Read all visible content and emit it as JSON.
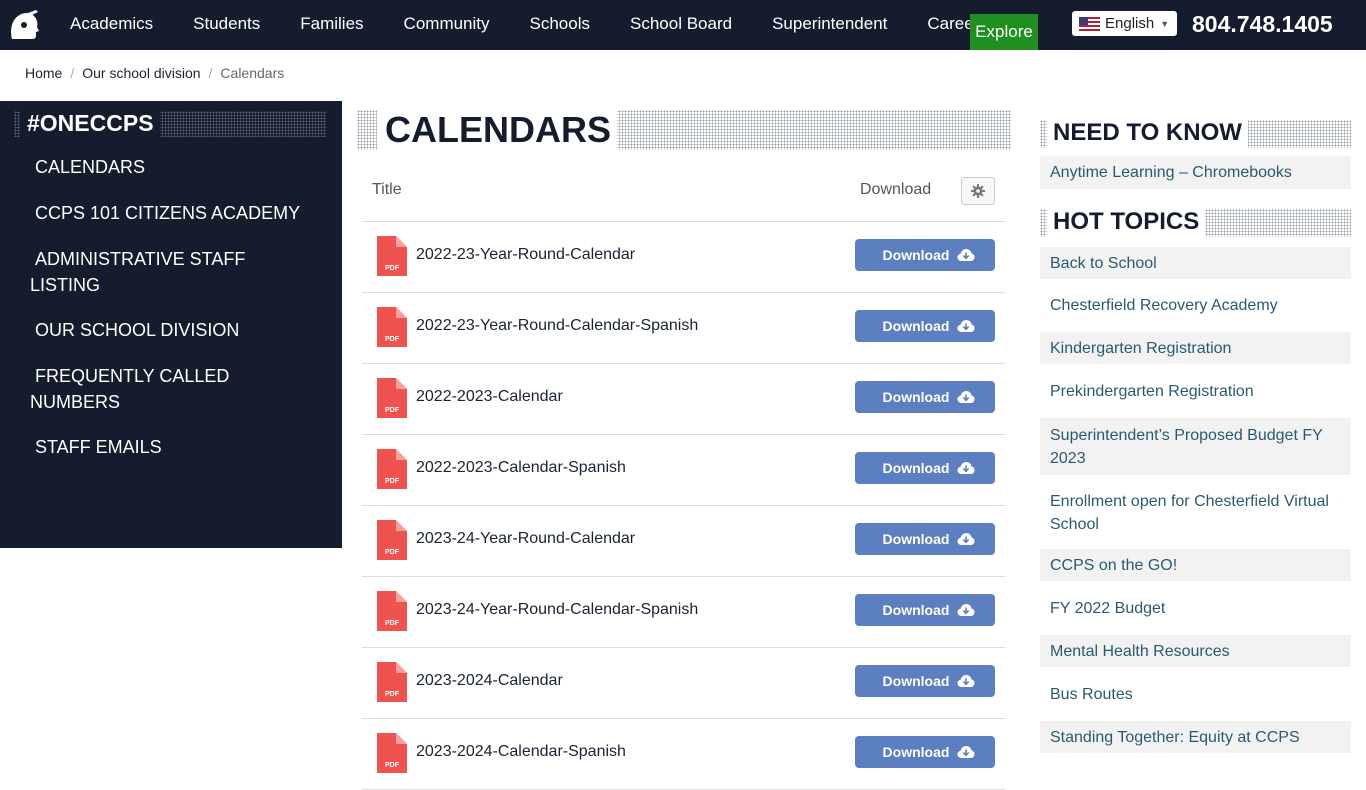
{
  "nav": {
    "items": [
      "Academics",
      "Students",
      "Families",
      "Community",
      "Schools",
      "School Board",
      "Superintendent",
      "Careers"
    ],
    "explore": "Explore",
    "language": "English",
    "phone": "804.748.1405"
  },
  "breadcrumb": {
    "home": "Home",
    "parent": "Our school division",
    "current": "Calendars"
  },
  "sidebar": {
    "heading": "#ONECCPS",
    "items": [
      {
        "label": "CALENDARS"
      },
      {
        "label": "CCPS 101 CITIZENS ACADEMY"
      },
      {
        "label": "ADMINISTRATIVE STAFF LISTING"
      },
      {
        "label": "OUR SCHOOL DIVISION"
      },
      {
        "label": "FREQUENTLY CALLED NUMBERS"
      },
      {
        "label": "STAFF EMAILS"
      }
    ]
  },
  "main": {
    "title": "CALENDARS",
    "columns": {
      "title": "Title",
      "download": "Download"
    },
    "download_label": "Download",
    "file_icon_text": "PDF",
    "files": [
      "2022-23-Year-Round-Calendar",
      "2022-23-Year-Round-Calendar-Spanish",
      "2022-2023-Calendar",
      "2022-2023-Calendar-Spanish",
      "2023-24-Year-Round-Calendar",
      "2023-24-Year-Round-Calendar-Spanish",
      "2023-2024-Calendar",
      "2023-2024-Calendar-Spanish"
    ]
  },
  "need_to_know": {
    "heading": "NEED TO KNOW",
    "links": [
      "Anytime Learning – Chromebooks"
    ]
  },
  "hot_topics": {
    "heading": "HOT TOPICS",
    "links": [
      "Back to School",
      "Chesterfield Recovery Academy",
      "Kindergarten Registration",
      "Prekindergarten Registration",
      "Superintendent’s Proposed Budget FY 2023",
      "Enrollment open for Chesterfield Virtual School",
      "CCPS on the GO!",
      "FY 2022 Budget",
      "Mental Health Resources",
      "Bus Routes",
      "Standing Together: Equity at CCPS"
    ]
  },
  "colors": {
    "navy": "#141c2e",
    "explore_green": "#1f8f1f",
    "download_blue": "#5b7fc1",
    "pdf_red": "#ef5350",
    "link_teal": "#2a5a72"
  }
}
